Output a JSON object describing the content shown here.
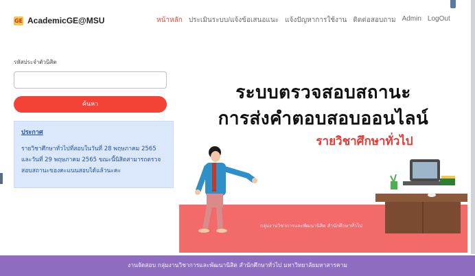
{
  "brand": {
    "logo_text": "GE",
    "name": "AcademicGE@MSU"
  },
  "nav": {
    "items": [
      {
        "label": "หน้าหลัก",
        "active": true
      },
      {
        "label": "ประเมินระบบ/แจ้งข้อเสนอแนะ",
        "active": false
      },
      {
        "label": "แจ้งปัญหาการใช้งาน",
        "active": false
      },
      {
        "label": "ติดต่อสอบถาม",
        "active": false
      },
      {
        "label": "Admin",
        "active": false
      },
      {
        "label": "LogOut",
        "active": false
      }
    ]
  },
  "search": {
    "label": "รหัสประจำตัวนิสิต",
    "value": "",
    "button_label": "ค้นหา"
  },
  "notice": {
    "title": "ประกาศ",
    "body": "รายวิชาศึกษาทั่วไปที่สอบในวันที่ 28 พฤษภาคม 2565 และวันที่ 29 พฤษภาคม 2565 ขณะนี้นิสิตสามารถตรวจสอบสถานะของคะแนนสอบได้แล้วนะคะ"
  },
  "hero": {
    "title_line1": "ระบบตรวจสอบสถานะ",
    "title_line2": "การส่งคำตอบสอบออนไลน์",
    "subtitle": "รายวิชาศึกษาทั่วไป",
    "caption": "กลุ่มงานวิชาการและพัฒนานิสิต สำนักศึกษาทั่วไป"
  },
  "footer": {
    "text": "งานจัดสอบ กลุ่มงานวิชาการและพัฒนานิสิต สำนักศึกษาทั่วไป มหาวิทยาลัยมหาสารคาม"
  },
  "colors": {
    "accent": "#f44336",
    "notice_bg": "#dbe8fb",
    "footer_bg": "#8e6cc0",
    "floor": "#f36a6a"
  }
}
